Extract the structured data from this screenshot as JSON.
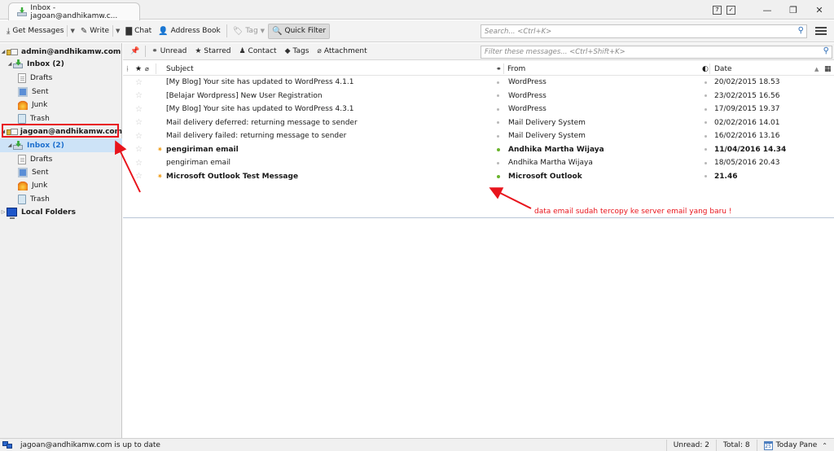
{
  "window": {
    "tab_title": "Inbox - jagoan@andhikamw.c...",
    "controls": {
      "minimize": "—",
      "maximize": "❐",
      "close": "✕"
    },
    "extra_icons": [
      "calendar-icon",
      "tasks-icon"
    ]
  },
  "toolbar": {
    "get_messages": "Get Messages",
    "write": "Write",
    "chat": "Chat",
    "address_book": "Address Book",
    "tag": "Tag",
    "quick_filter": "Quick Filter",
    "search_placeholder": "Search... <Ctrl+K>"
  },
  "sidebar": {
    "accounts": [
      {
        "name": "admin@andhikamw.com",
        "folders": [
          {
            "label": "Inbox (2)",
            "type": "inbox",
            "bold": true
          },
          {
            "label": "Drafts",
            "type": "drafts"
          },
          {
            "label": "Sent",
            "type": "sent"
          },
          {
            "label": "Junk",
            "type": "junk"
          },
          {
            "label": "Trash",
            "type": "trash"
          }
        ]
      },
      {
        "name": "jagoan@andhikamw.com",
        "folders": [
          {
            "label": "Inbox (2)",
            "type": "inbox",
            "bold": true,
            "selected": true
          },
          {
            "label": "Drafts",
            "type": "drafts"
          },
          {
            "label": "Sent",
            "type": "sent"
          },
          {
            "label": "Junk",
            "type": "junk"
          },
          {
            "label": "Trash",
            "type": "trash"
          }
        ]
      }
    ],
    "local_folders": "Local Folders"
  },
  "quickfilter": {
    "unread": "Unread",
    "starred": "Starred",
    "contact": "Contact",
    "tags": "Tags",
    "attachment": "Attachment",
    "filter_placeholder": "Filter these messages... <Ctrl+Shift+K>"
  },
  "columns": {
    "subject": "Subject",
    "from": "From",
    "date": "Date"
  },
  "messages": [
    {
      "subject": "[My Blog] Your site has updated to WordPress 4.1.1",
      "from": "WordPress",
      "date": "20/02/2015 18.53",
      "unread": false
    },
    {
      "subject": "[Belajar Wordpress] New User Registration",
      "from": "WordPress",
      "date": "23/02/2015 16.56",
      "unread": false
    },
    {
      "subject": "[My Blog] Your site has updated to WordPress 4.3.1",
      "from": "WordPress",
      "date": "17/09/2015 19.37",
      "unread": false
    },
    {
      "subject": "Mail delivery deferred: returning message to sender",
      "from": "Mail Delivery System",
      "date": "02/02/2016 14.01",
      "unread": false
    },
    {
      "subject": "Mail delivery failed: returning message to sender",
      "from": "Mail Delivery System",
      "date": "16/02/2016 13.16",
      "unread": false
    },
    {
      "subject": "pengiriman email",
      "from": "Andhika Martha Wijaya",
      "date": "11/04/2016 14.34",
      "unread": true
    },
    {
      "subject": "pengiriman email",
      "from": "Andhika Martha Wijaya",
      "date": "18/05/2016 20.43",
      "unread": false
    },
    {
      "subject": "Microsoft Outlook Test Message",
      "from": "Microsoft Outlook",
      "date": "21.46",
      "unread": true
    }
  ],
  "annotation": "data email sudah tercopy ke server email yang baru !",
  "status": {
    "message": "jagoan@andhikamw.com is up to date",
    "unread": "Unread: 2",
    "total": "Total: 8",
    "today_pane": "Today Pane",
    "today_day": "25"
  },
  "colors": {
    "annotation_red": "#e8141c",
    "selected_bg": "#cde3f7",
    "selected_text": "#1d6fce",
    "online_green": "#6ab42d"
  }
}
